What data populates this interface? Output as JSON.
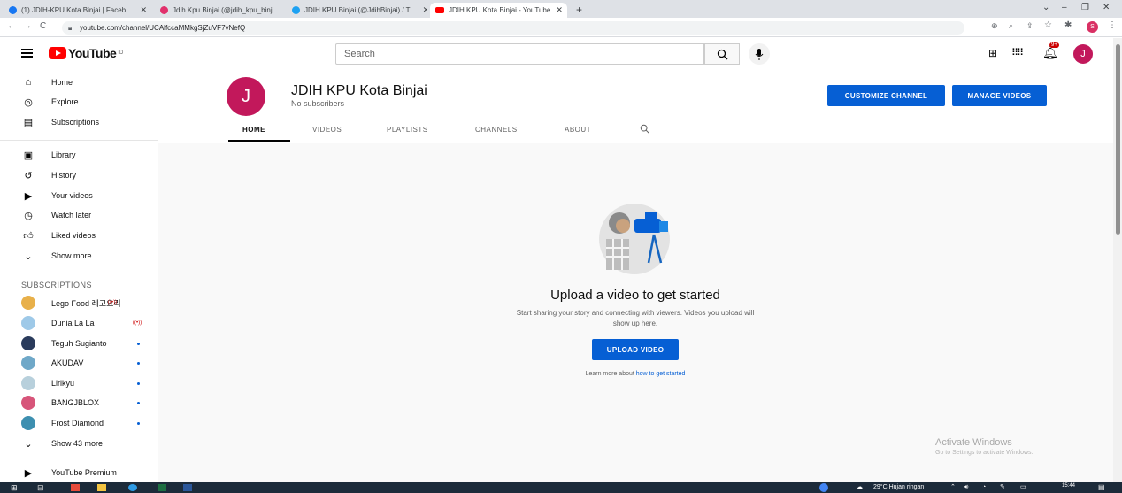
{
  "browser": {
    "tabs": [
      {
        "label": "(1) JDIH-KPU Kota Binjai | Faceb…",
        "icon_color": "#1877f2"
      },
      {
        "label": "Jdih Kpu Binjai (@jdih_kpu_binj…",
        "icon_color": "#e1306c"
      },
      {
        "label": "JDIH KPU Binjai (@JdihBinjai) / T…",
        "icon_color": "#1da1f2"
      },
      {
        "label": "JDIH KPU Kota Binjai - YouTube",
        "icon_color": "#ff0000"
      }
    ],
    "new_tab": "+",
    "url": "youtube.com/channel/UCAlfccaMMkgSjZuVF7vNefQ"
  },
  "youtube": {
    "logo": "YouTube",
    "logo_region": "ID",
    "search_placeholder": "Search",
    "notification_badge": "9+",
    "user_initial": "J"
  },
  "sidebar": {
    "main": [
      {
        "label": "Home",
        "icon": "home-icon"
      },
      {
        "label": "Explore",
        "icon": "compass-icon"
      },
      {
        "label": "Subscriptions",
        "icon": "subscriptions-icon"
      }
    ],
    "library": [
      {
        "label": "Library",
        "icon": "library-icon"
      },
      {
        "label": "History",
        "icon": "history-icon"
      },
      {
        "label": "Your videos",
        "icon": "play-icon"
      },
      {
        "label": "Watch later",
        "icon": "clock-icon"
      },
      {
        "label": "Liked videos",
        "icon": "thumb-up-icon"
      },
      {
        "label": "Show more",
        "icon": "chevron-down-icon"
      }
    ],
    "subscriptions_heading": "SUBSCRIPTIONS",
    "subscriptions": [
      {
        "label": "Lego Food 레고요리",
        "badge": "live",
        "color": "#e8b04a"
      },
      {
        "label": "Dunia La La",
        "badge": "live",
        "color": "#9ec9e8"
      },
      {
        "label": "Teguh Sugianto",
        "badge": "dot",
        "color": "#2a3b5c"
      },
      {
        "label": "AKUDAV",
        "badge": "dot",
        "color": "#6fa8c8"
      },
      {
        "label": "Lirikyu",
        "badge": "dot",
        "color": "#b8d0dc"
      },
      {
        "label": "BANGJBLOX",
        "badge": "dot",
        "color": "#d7557a"
      },
      {
        "label": "Frost Diamond",
        "badge": "dot",
        "color": "#3d8fb0"
      }
    ],
    "show_more_subs": "Show 43 more",
    "premium": "YouTube Premium"
  },
  "channel": {
    "initial": "J",
    "name": "JDIH KPU Kota Binjai",
    "subscribers": "No subscribers",
    "customize_button": "CUSTOMIZE CHANNEL",
    "manage_button": "MANAGE VIDEOS",
    "tabs": [
      "HOME",
      "VIDEOS",
      "PLAYLISTS",
      "CHANNELS",
      "ABOUT"
    ],
    "active_tab": "HOME"
  },
  "empty_state": {
    "title": "Upload a video to get started",
    "description_line1": "Start sharing your story and connecting with viewers. Videos you upload will",
    "description_line2": "show up here.",
    "upload_button": "UPLOAD VIDEO",
    "learn_prefix": "Learn more about ",
    "learn_link": "how to get started"
  },
  "watermark": {
    "line1": "Activate Windows",
    "line2": "Go to Settings to activate Windows."
  },
  "taskbar": {
    "weather": "29°C  Hujan ringan",
    "time": "15:44"
  },
  "colors": {
    "brand_red": "#ff0000",
    "accent_blue": "#065fd4",
    "avatar": "#c2185b"
  }
}
